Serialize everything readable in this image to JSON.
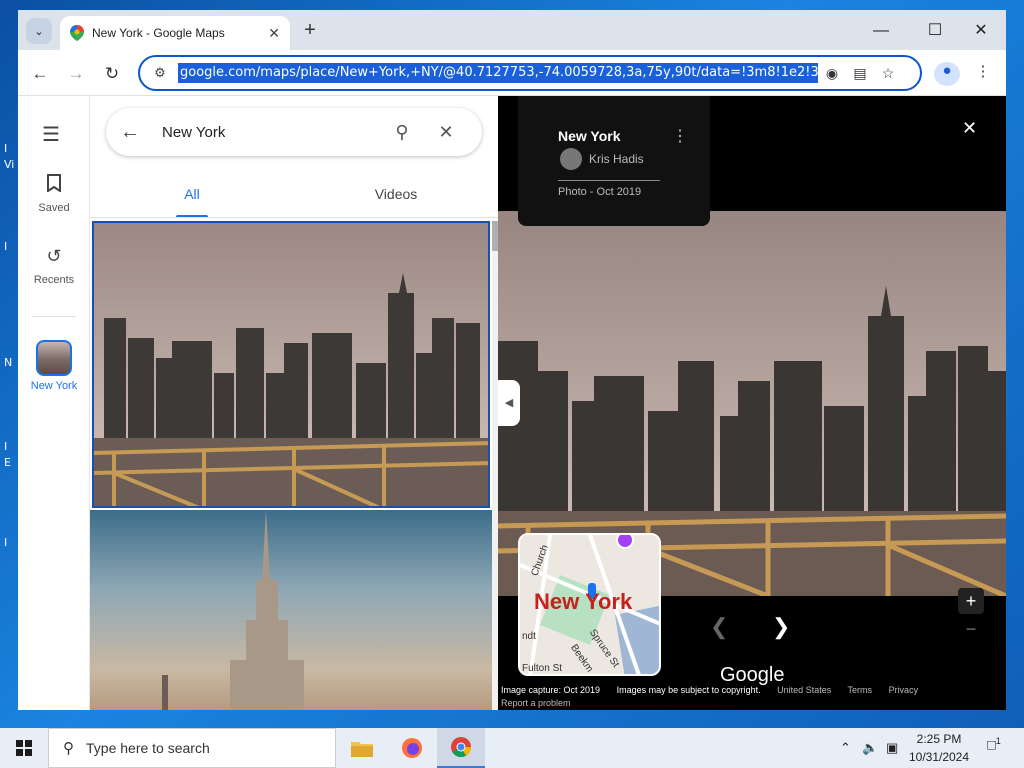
{
  "desktop": {
    "fragments": [
      "I",
      "Vi",
      "I",
      "N",
      "I",
      "E",
      "I"
    ]
  },
  "browser": {
    "tab_title": "New York - Google Maps",
    "url": "google.com/maps/place/New+York,+NY/@40.7127753,-74.0059728,3a,75y,90t/data=!3m8!1e2!3m6!1sA"
  },
  "rail": {
    "saved_label": "Saved",
    "recents_label": "Recents",
    "place_label": "New York"
  },
  "panel": {
    "search_value": "New York",
    "tabs": [
      {
        "label": "All",
        "active": true
      },
      {
        "label": "Videos",
        "active": false
      }
    ]
  },
  "viewer": {
    "title": "New York",
    "author": "Kris Hadis",
    "photo_date": "Photo - Oct 2019",
    "minimap_label": "New York",
    "minimap_streets": [
      "Church",
      "ndt",
      "Spruce St",
      "Beekm",
      "Fulton St"
    ],
    "logo": "Google",
    "footer": {
      "capture": "Image capture: Oct 2019",
      "copyright": "Images may be subject to copyright.",
      "country": "United States",
      "terms": "Terms",
      "privacy": "Privacy",
      "report": "Report a problem"
    }
  },
  "taskbar": {
    "search_placeholder": "Type here to search",
    "time": "2:25 PM",
    "date": "10/31/2024",
    "notification_count": "1"
  },
  "colors": {
    "accent": "#1a73e8",
    "url_highlight": "#1a60d8",
    "minimap_label": "#c5221f"
  }
}
